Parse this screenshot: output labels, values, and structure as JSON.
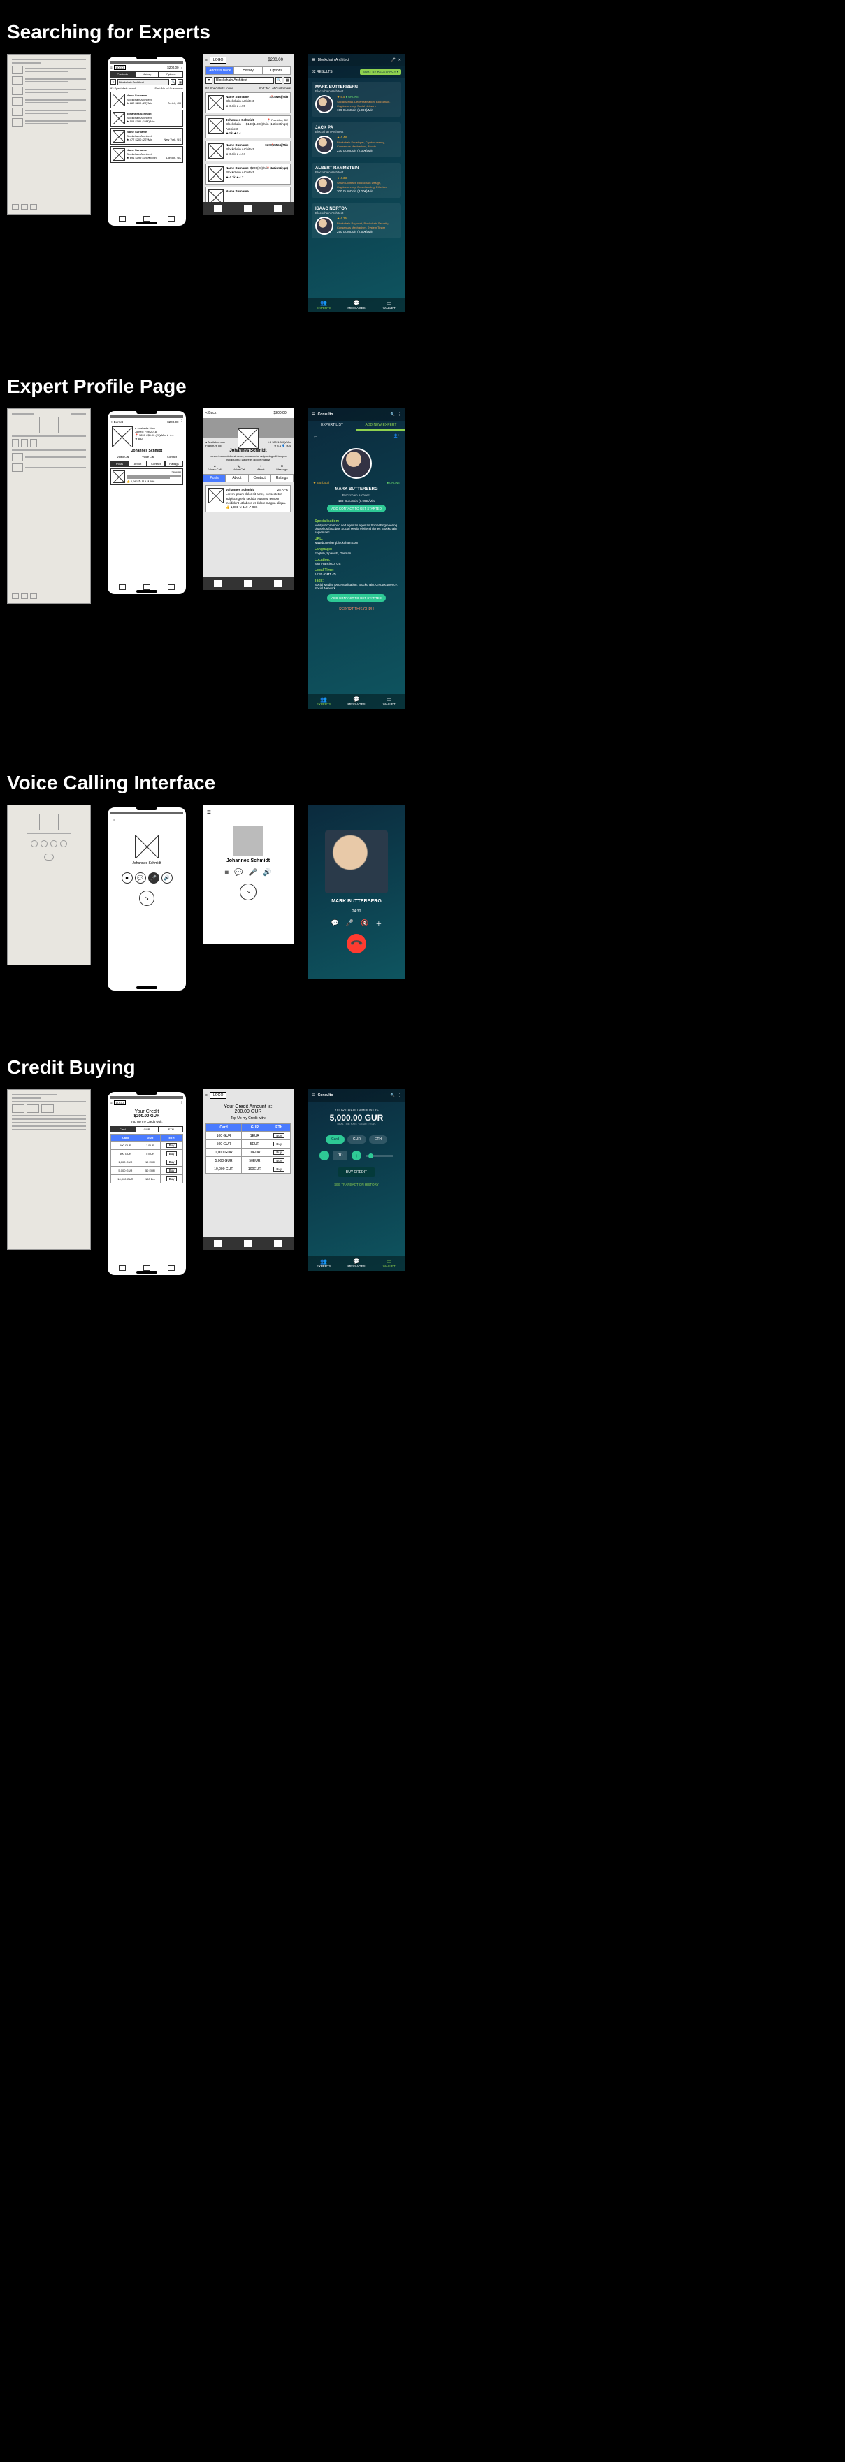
{
  "sections": {
    "search": "Searching for Experts",
    "profile": "Expert Profile Page",
    "call": "Voice Calling Interface",
    "credit": "Credit Buying"
  },
  "common": {
    "logo": "LOGO",
    "app_name": "Consulto",
    "balance_lo": "$200.00",
    "balance_wire": "$200.00",
    "balance_hifi": "$200.00",
    "back": "Back",
    "burnet": "Burnet"
  },
  "tabs": {
    "contacts": "Contacts",
    "addressbook": "Address Book",
    "history": "History",
    "options": "Options"
  },
  "search_screen": {
    "query": "Blockchain Architect",
    "results_count_lo": "92 Specialists found",
    "results_count_wire": "92 Specialists found",
    "sort_label": "Sort: No. of Customers",
    "hifi_results": "32 RESULTS",
    "hifi_sort": "SORT BY RELEVANCY ▾"
  },
  "lo_experts": [
    {
      "name": "Name Surname",
      "role": "Blockchain Architect",
      "rating": "★ 882",
      "price": "$200 (2€)/Min",
      "loc": "Zurich, CH"
    },
    {
      "name": "Johannes Schmidt",
      "role": "Blockchain Architect",
      "rating": "★ 504",
      "price": "$181 (1.8€)/Min",
      "loc": ""
    },
    {
      "name": "Name Surname",
      "role": "Blockchain Architect",
      "rating": "★ 477",
      "price": "$200 (2€)/Min",
      "loc": "New York, US"
    },
    {
      "name": "Name Surname",
      "role": "Blockchain Architect",
      "rating": "★ 691",
      "price": "$199 (1.99€)/Min",
      "loc": "London, UK"
    }
  ],
  "wire_experts": [
    {
      "name": "Name Surname",
      "role": "Blockchain Architect",
      "rating": "★ 6.6k ★4.76",
      "price": "$200(2€)/Min",
      "loc": "📍 Zurich, CH"
    },
    {
      "name": "Johannes Schmidt",
      "role": "Blockchain Architect",
      "rating": "★ 5k ★4.4",
      "price": "$180(1.80€)/Min (1.2k ratings)",
      "loc": "📍 Frankfurt, DE"
    },
    {
      "name": "Name Surname",
      "role": "Blockchain Architect",
      "rating": "★ 6.6k ★4.74",
      "price": "$200(2.50€)/Min",
      "loc": "📍 Berlin, DE"
    },
    {
      "name": "Name Surname",
      "role": "Blockchain Architect",
      "rating": "★ 4.3k ★4.2",
      "price": "$200(2€)/Min (1.3k ratings)",
      "loc": "📍 New York, US"
    },
    {
      "name": "Name Surname",
      "role": "",
      "rating": "",
      "price": "",
      "loc": ""
    }
  ],
  "hifi_experts": [
    {
      "name": "MARK BUTTERBERG",
      "role": "Blockchain Architect",
      "rating": "★ 4.5",
      "online": "● ONLINE",
      "tags": "Social Media, Decentralisation, Blockchain, Cryptocurrency, Social Network",
      "price": "199 GuruCoin (1.99€)/Min"
    },
    {
      "name": "JACK PA",
      "role": "Blockchain Architect",
      "rating": "★ 4.48",
      "online": "",
      "tags": "Blockchain Developer, Cryptocurrency, Consensus Mechanism, Bitcoin",
      "price": "230 GuruCoin (2.30€)/Min"
    },
    {
      "name": "ALBERT RAMMSTEIN",
      "role": "Blockchain Architect",
      "rating": "★ 4.33",
      "online": "",
      "tags": "Smart Contract, Blockchain Design, Cryptocurrency, Crowdfunding, Etherium",
      "price": "300 GuruCoin (3.00€)/Min"
    },
    {
      "name": "ISAAC NORTON",
      "role": "Blockchain Architect",
      "rating": "★ 4.35",
      "online": "",
      "tags": "Blockchain Payment, Blockchain Security, Consensus Mechanism, System Tester",
      "price": "250 GuruCoin (2.50€)/Min"
    }
  ],
  "nav": {
    "experts": "EXPERTS",
    "messages": "MESSAGES",
    "wallet": "WALLET"
  },
  "profile": {
    "expert_list_tab": "EXPERT LIST",
    "add_expert_tab": "ADD NEW EXPERT",
    "name": "MARK BUTTERBERG",
    "role": "Blockchain Architect",
    "price": "199 GuruCoin (1.99€)/Min",
    "rating": "★ 4.5 (303)",
    "online": "● ONLINE",
    "cta": "ADD CONTACT TO GET STARTED",
    "report": "REPORT THIS GURU",
    "spec_label": "Specialisation:",
    "spec_text": "volutpat commodo sed egestas egestas Social Engineering phasellus faucibus Social Media eleifend donec Blockchain sapien nec",
    "url_label": "URL:",
    "url": "www.butterbergblockchain.com",
    "lang_label": "Language:",
    "lang": "English, Spanish, German",
    "loc_label": "Location:",
    "loc": "San Francisco, US",
    "time_label": "Local Time:",
    "time": "14:30 (GMT -7)",
    "tags_label": "Tags:",
    "tags": "Social Media, Decentralisation, Blockchain, Cryptocurrency, Social Network"
  },
  "wire_profile": {
    "back": "< Back",
    "balance": "$200.00 ⋮",
    "available": "● Available now",
    "loc": "Frankfurt, DE",
    "name": "Johannes Schmidt",
    "rate": "↓$ 180(1.80€)/Min",
    "rating": "★ 4.4",
    "customers": "👤 504",
    "desc": "Lorem ipsum dolor sit amet, consectetur adipiscing elit tempor incididunt ut labore et dolore magna",
    "video": "Video Call",
    "voice": "Voice Call",
    "about": "About",
    "message": "Message",
    "tab_posts": "Posts",
    "tab_about": "About",
    "tab_contact": "Contact",
    "tab_ratings": "Ratings",
    "post_name": "Johannes Schmidt",
    "post_date": "28 APR",
    "post_text": "Lorem ipsum dolor sit amet, consectetur adipiscing elit, sed do eiusmod tempor incididunt ut labore et dolore magna aliqua.",
    "stats": "👍 1,981  ↻ 119  ↗ 996"
  },
  "lo_profile": {
    "available": "● Available Now",
    "joined": "Joined: Feb 2018",
    "name": "Johannes Schmidt",
    "stats": "📍 $200 / $5.00 (2€)/Min  ★ 4.4",
    "rating": "★ 882",
    "video": "Video Call",
    "voice": "Voice Call",
    "contact": "Contact",
    "tab_posts": "Posts",
    "tab_about": "About",
    "tab_contact": "Contact",
    "tab_ratings": "Ratings",
    "date": "28 APR",
    "likes": "👍 1,981  ↻ 119  ↗ 996"
  },
  "call": {
    "name_lo": "Johannes Schmidt",
    "name_wire": "Johannes Schmidt",
    "name_hifi": "MARK BUTTERBERG",
    "timer": "24:30"
  },
  "credit": {
    "wire_title": "Your Credit Amount is:",
    "wire_amount": "200.00 GUR",
    "wire_topup": "Top Up my Credit with:",
    "lo_title": "Your Credit",
    "lo_amount": "$200.00 GUR",
    "lo_topup": "Top Up my Credit with:",
    "tabs": {
      "card": "Card",
      "gur": "GUR",
      "eth": "ETH"
    },
    "rows": [
      {
        "g": "100 GUR",
        "e": "1EUR",
        "b": "Buy"
      },
      {
        "g": "500 GUR",
        "e": "5EUR",
        "b": "Buy"
      },
      {
        "g": "1,000 GUR",
        "e": "10EUR",
        "b": "Buy"
      },
      {
        "g": "5,000 GUR",
        "e": "50EUR",
        "b": "Buy"
      },
      {
        "g": "10,000 GUR",
        "e": "100EUR",
        "b": "Buy"
      }
    ],
    "lo_rows": [
      {
        "g": "100 GUR",
        "e": "1 EUR",
        "b": "Buy"
      },
      {
        "g": "500 GUR",
        "e": "5 EUR",
        "b": "Buy"
      },
      {
        "g": "1,000 GUR",
        "e": "10 EUR",
        "b": "Buy"
      },
      {
        "g": "5,000 GUR",
        "e": "50 EUR",
        "b": "Buy"
      },
      {
        "g": "10,000 GUR",
        "e": "100 Eur",
        "b": "Buy"
      }
    ],
    "hifi_label": "YOUR CREDIT AMOUNT IS",
    "hifi_amount": "5,000.00 GUR",
    "hifi_sub": "REAL TIME RATE · 1 GUR = 0.01€",
    "hifi_step": "10",
    "hifi_buy": "BUY CREDIT",
    "hifi_history": "SEE TRANSACTION HISTORY"
  }
}
